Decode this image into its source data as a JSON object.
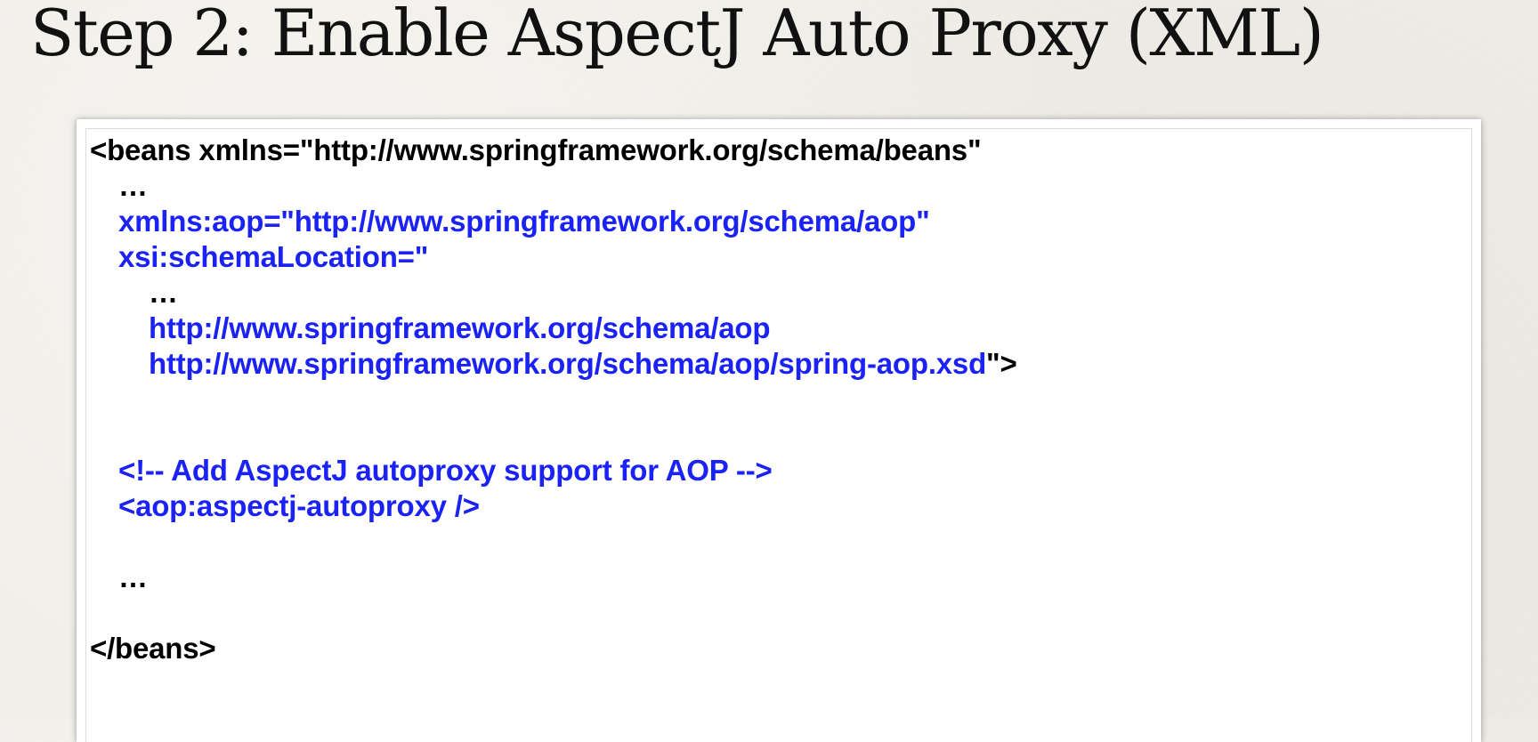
{
  "title": "Step 2: Enable AspectJ Auto Proxy (XML)",
  "colors": {
    "markup": "#000000",
    "highlight": "#1a22f5",
    "background": "#efede7",
    "card": "#ffffff"
  },
  "code": {
    "beans_open": "<beans xmlns=\"http://www.springframework.org/schema/beans\"",
    "ellipsis_1": "…",
    "xmlns_aop": "xmlns:aop=\"http://www.springframework.org/schema/aop\"",
    "schema_location": "xsi:schemaLocation=\"",
    "ellipsis_2": "…",
    "aop_schema_url": "http://www.springframework.org/schema/aop",
    "aop_xsd_url": "http://www.springframework.org/schema/aop/spring-aop.xsd",
    "tag_close": "\">",
    "comment": "<!-- Add AspectJ autoproxy support for AOP -->",
    "autoproxy_tag": "<aop:aspectj-autoproxy />",
    "ellipsis_3": "…",
    "beans_close": "</beans>"
  }
}
